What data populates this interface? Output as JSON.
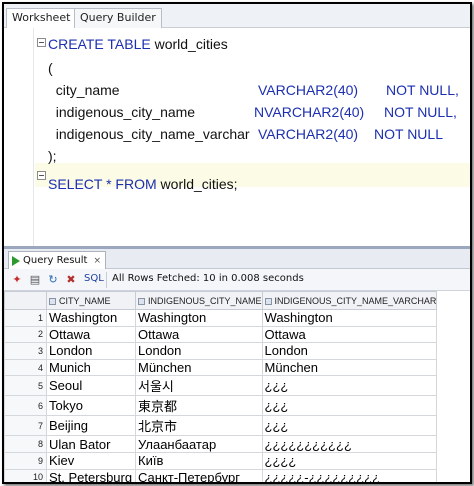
{
  "tabs": [
    "Worksheet",
    "Query Builder"
  ],
  "editor": {
    "lines": [
      {
        "parts": [
          {
            "t": "CREATE TABLE",
            "kw": true
          },
          {
            "t": " world_cities",
            "kw": false
          }
        ]
      },
      {
        "parts": [
          {
            "t": "(",
            "kw": false
          }
        ]
      },
      {
        "parts": [
          {
            "t": "  city_name",
            "kw": false
          }
        ],
        "type": "VARCHAR2(40)",
        "constraint": "NOT NULL,"
      },
      {
        "parts": [
          {
            "t": "  indigenous_city_name",
            "kw": false
          }
        ],
        "type": "NVARCHAR2(40)",
        "constraint": "NOT NULL,"
      },
      {
        "parts": [
          {
            "t": "  indigenous_city_name_varchar",
            "kw": false
          }
        ],
        "type": "VARCHAR2(40)",
        "constraint": "NOT NULL"
      },
      {
        "parts": [
          {
            "t": ");",
            "kw": false
          }
        ]
      },
      {
        "parts": [
          {
            "t": "SELECT * FROM",
            "kw": true
          },
          {
            "t": " world_cities;",
            "kw": false
          }
        ]
      }
    ]
  },
  "results": {
    "tab_label": "Query Result",
    "close_glyph": "×",
    "sql_label": "SQL",
    "fetch_status": "All Rows Fetched: 10 in 0.008 seconds",
    "columns": [
      "CITY_NAME",
      "INDIGENOUS_CITY_NAME",
      "INDIGENOUS_CITY_NAME_VARCHAR"
    ],
    "rows": [
      [
        "1",
        "Washington",
        "Washington",
        "Washington"
      ],
      [
        "2",
        "Ottawa",
        "Ottawa",
        "Ottawa"
      ],
      [
        "3",
        "London",
        "London",
        "London"
      ],
      [
        "4",
        "Munich",
        "München",
        "München"
      ],
      [
        "5",
        "Seoul",
        "서울시",
        "¿¿¿"
      ],
      [
        "6",
        "Tokyo",
        "東京都",
        "¿¿¿"
      ],
      [
        "7",
        "Beijing",
        "北京市",
        "¿¿¿"
      ],
      [
        "8",
        "Ulan Bator",
        "Улаанбаатар",
        "¿¿¿¿¿¿¿¿¿¿¿"
      ],
      [
        "9",
        "Kiev",
        "Київ",
        "¿¿¿¿"
      ],
      [
        "10",
        "St. Petersburg",
        "Санкт-Петербург",
        "¿¿¿¿¿-¿¿¿¿¿¿¿¿¿"
      ]
    ]
  },
  "colors": {
    "keyword": "#1c2fb0",
    "current_line": "#fbfbe6",
    "run_icon": "#2e9a2e"
  }
}
